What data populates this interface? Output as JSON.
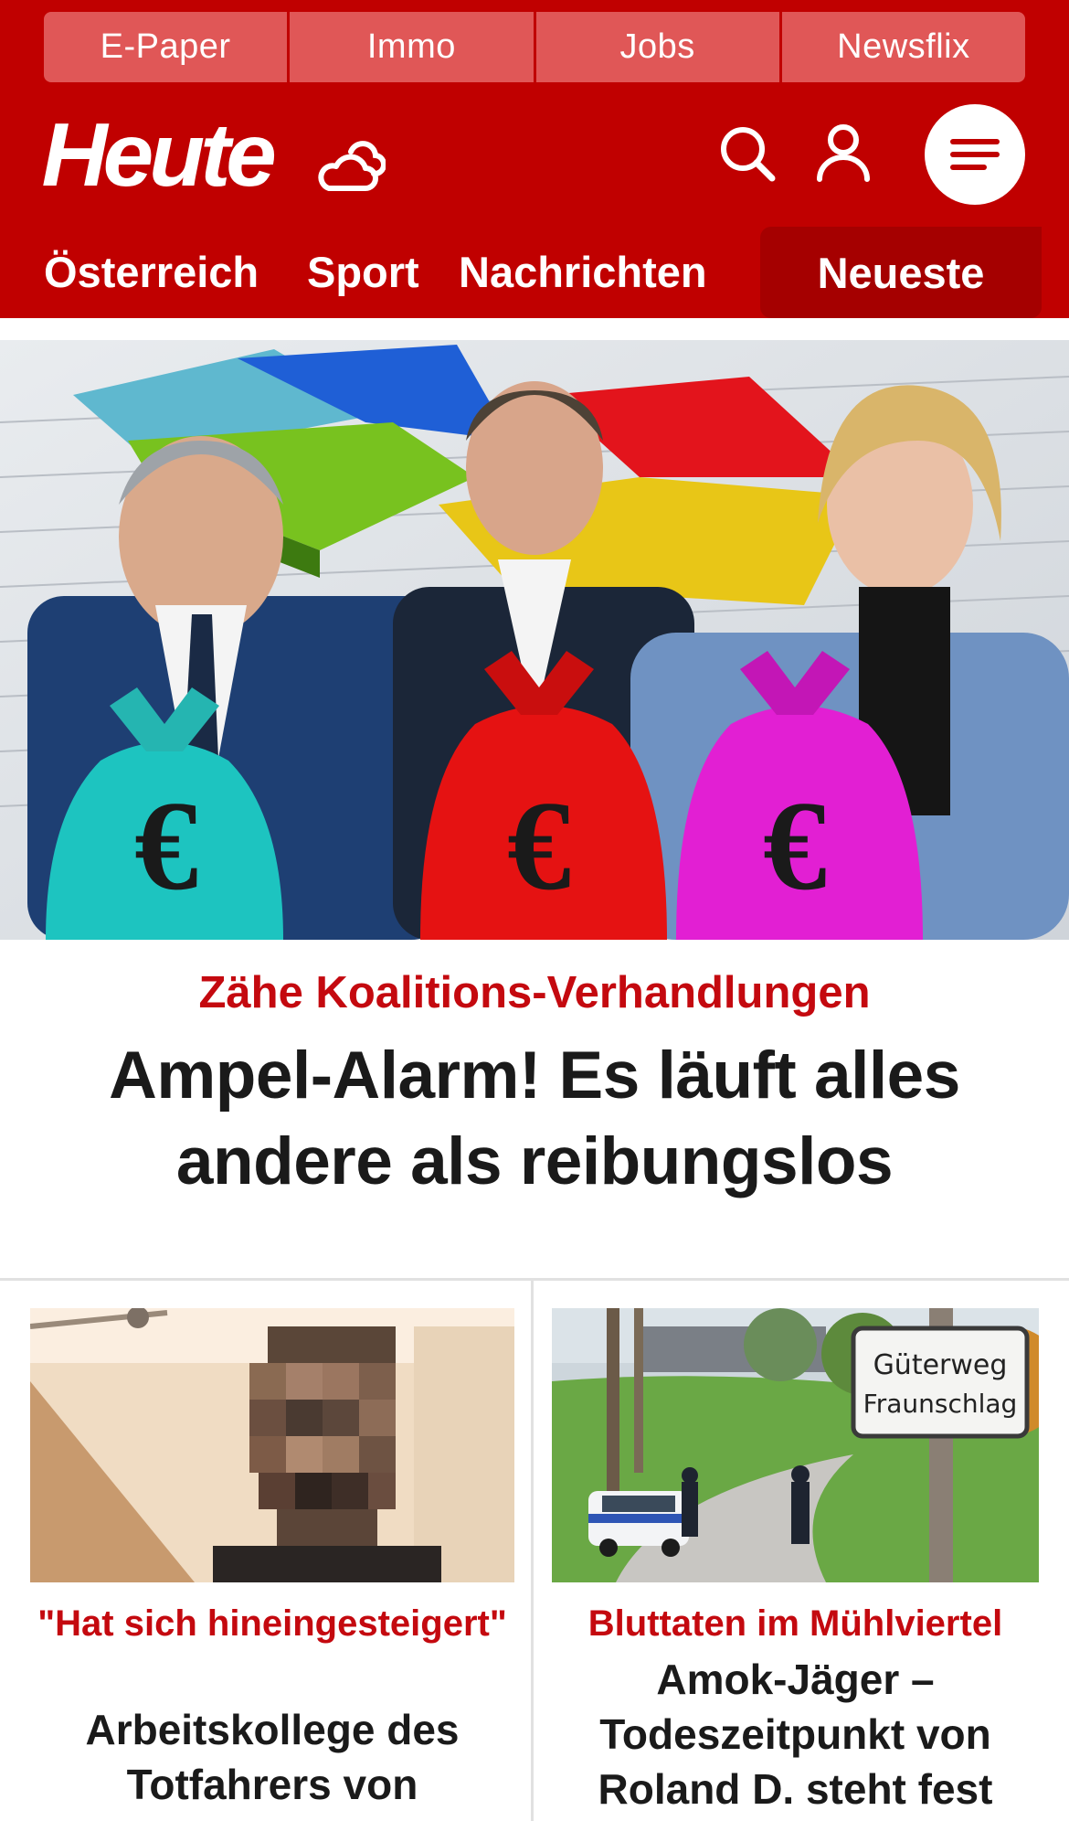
{
  "quicklinks": [
    {
      "label": "E-Paper"
    },
    {
      "label": "Immo"
    },
    {
      "label": "Jobs"
    },
    {
      "label": "Newsflix"
    }
  ],
  "brand": {
    "logo_text": "Heute",
    "weather_icon": "cloud-sun-icon",
    "color": "#c00000",
    "accent_dark": "#a50000"
  },
  "header_icons": {
    "search": "search-icon",
    "account": "user-icon",
    "menu": "hamburger-menu-icon"
  },
  "nav": {
    "items": [
      {
        "label": "Österreich"
      },
      {
        "label": "Sport"
      },
      {
        "label": "Nachrichten"
      }
    ],
    "active_label": "Neueste"
  },
  "hero": {
    "kicker": "Zähe Koalitions-Verhandlungen",
    "title": "Ampel-Alarm! Es läuft alles andere als reibungslos",
    "image_alt": "politicians-with-money-bags"
  },
  "teasers": [
    {
      "kicker": "\"Hat sich hineingesteigert\"",
      "title": "Arbeitskollege des Totfahrers von Mauthausen packt aus",
      "image_alt": "pixelated-man-photo"
    },
    {
      "kicker": "Bluttaten im Mühlviertel",
      "title": "Amok-Jäger – Todeszeitpunkt von Roland D. steht fest",
      "image_alt": "police-at-road-sign",
      "sign_line1": "Güterweg",
      "sign_line2": "Fraunschlag"
    }
  ]
}
